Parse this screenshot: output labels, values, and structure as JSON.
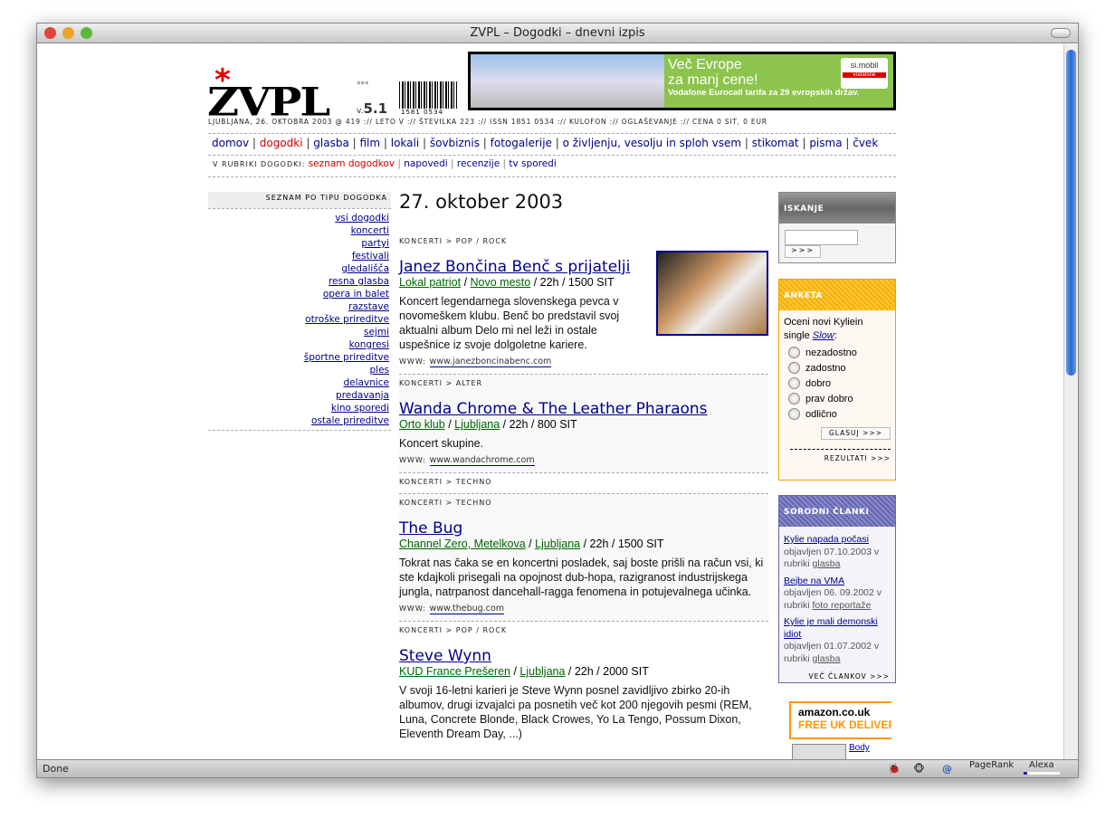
{
  "window": {
    "title": "ZVPL – Dogodki – dnevni izpis",
    "status": "Done",
    "status_items": [
      "PageRank",
      "Alexa"
    ],
    "alexa_level": 0.1
  },
  "header": {
    "logo": "ZVPL",
    "stars": "***",
    "version_prefix": "v.",
    "version": "5.1",
    "barcode": "1581 0534",
    "infoline": "LJUBLJANA, 26. OKTOBRA 2003 @ 419 :// LETO V :// ŠTEVILKA 223 :// ISSN 1851 0534 :// KULOFON :// OGLAŠEVANJE :// CENA 0 SIT, 0 EUR",
    "banner": {
      "line1": "Več Evrope",
      "line2": "za manj cene!",
      "line3": "Vodafone Eurocall tarifa za 29 evropskih držav.",
      "brand": "si.mobil",
      "brand2": "vodafone"
    }
  },
  "nav": {
    "items": [
      "domov",
      "dogodki",
      "glasba",
      "film",
      "lokali",
      "šovbiznis",
      "fotogalerije",
      "o življenju, vesolju in sploh vsem",
      "stikomat",
      "pisma",
      "čvek"
    ],
    "active": "dogodki"
  },
  "subnav": {
    "label": "V RUBRIKI DOGODKI:",
    "items": [
      "seznam dogodkov",
      "napovedi",
      "recenzije",
      "tv sporedi"
    ]
  },
  "sidebar": {
    "title": "SEZNAM PO TIPU DOGODKA",
    "items": [
      "vsi dogodki",
      "koncerti",
      "partyi",
      "festivali",
      "gledališča",
      "resna glasba",
      "opera in balet",
      "razstave",
      "otroške prireditve",
      "sejmi",
      "kongresi",
      "športne prireditve",
      "ples",
      "delavnice",
      "predavanja",
      "kino sporedi",
      "ostale prireditve"
    ]
  },
  "main": {
    "date": "27. oktober 2003",
    "www_label": "WWW:",
    "events": [
      {
        "category": "KONCERTI > POP / ROCK",
        "title": "Janez Bončina Benč s prijatelji",
        "venue": "Lokal patriot",
        "city": "Novo mesto",
        "info": " / 22h / 1500 SIT",
        "desc": "Koncert legendarnega slovenskega pevca v novomeškem klubu. Benč bo predstavil svoj aktualni album Delo mi nel leži in ostale uspešnice iz svoje dolgoletne kariere.",
        "www": "www.janezboncinabenc.com"
      },
      {
        "category": "KONCERTI > ALTER",
        "title": "Wanda Chrome & The Leather Pharaons",
        "venue": "Orto klub",
        "city": "Ljubljana",
        "info": " / 22h / 800 SIT",
        "desc": "Koncert skupine.",
        "www": "www.wandachrome.com"
      },
      {
        "category": "KONCERTI > TECHNO"
      },
      {
        "category": "KONCERTI > TECHNO",
        "title": "The Bug",
        "venue": "Channel Zero, Metelkova",
        "city": "Ljubljana",
        "info": " / 22h / 1500 SIT",
        "desc": "Tokrat nas čaka se en koncertni posladek, saj boste prišli na račun vsi, ki ste kdajkoli prisegali na opojnost dub-hopa, razigranost industrijskega jungla, natrpanost dancehall-ragga fenomena in potujevalnega učinka.",
        "www": "www.thebug.com"
      },
      {
        "category": "KONCERTI > POP / ROCK",
        "title": "Steve Wynn",
        "venue": "KUD France Prešeren",
        "city": "Ljubljana",
        "info": " / 22h / 2000 SIT",
        "desc": "V svoji 16-letni karieri je Steve Wynn posnel zavidljivo zbirko 20-ih albumov, drugi izvajalci pa posnetih več kot 200 njegovih pesmi (REM, Luna, Concrete Blonde, Black Crowes, Yo La Tengo, Possum Dixon, Eleventh Dream Day, ...)"
      }
    ]
  },
  "search": {
    "title": "ISKANJE",
    "button": ">>>",
    "value": ""
  },
  "poll": {
    "title": "ANKETA",
    "q1": "Oceni novi Kyliein single ",
    "q_link": "Slow",
    "q2": ":",
    "options": [
      "nezadostno",
      "zadostno",
      "dobro",
      "prav dobro",
      "odlično"
    ],
    "vote": "GLASUJ >>>",
    "results": "REZULTATI >>>"
  },
  "related": {
    "title": "SORODNI ČLANKI",
    "items": [
      {
        "title": "Kylie napada počasi",
        "date": "objavljen 07.10.2003 v",
        "rubric_prefix": "rubriki ",
        "rubric": "glasba"
      },
      {
        "title": "Bejbe na VMA",
        "date": "objavljen 06. 09.2002 v",
        "rubric_prefix": "rubriki ",
        "rubric": "foto reportaže"
      },
      {
        "title": "Kylie je mali demonski idiot",
        "date": "objavljen 01.07.2002 v",
        "rubric_prefix": "rubriki ",
        "rubric": "glasba"
      }
    ],
    "more": "VEČ ČLANKOV >>>"
  },
  "amazon": {
    "logo": "amazon.co.uk",
    "tagline": "FREE UK DELIVERY",
    "item": "Body"
  },
  "colors": {
    "link": "#00008b",
    "venue": "#006400",
    "active": "#cc0000",
    "poll": "#f0a000",
    "related": "#6666aa",
    "search": "#777777"
  }
}
